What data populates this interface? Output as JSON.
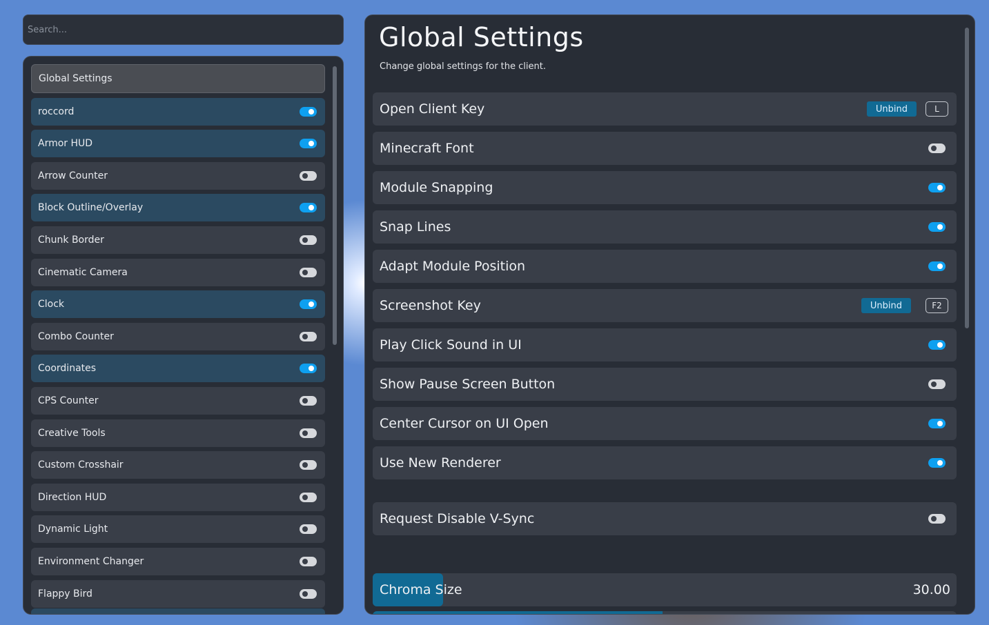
{
  "search": {
    "placeholder": "Search..."
  },
  "sidebar": {
    "items": [
      {
        "label": "Global Settings",
        "type": "header"
      },
      {
        "label": "roccord",
        "enabled": true
      },
      {
        "label": "Armor HUD",
        "enabled": true
      },
      {
        "label": "Arrow Counter",
        "enabled": false
      },
      {
        "label": "Block Outline/Overlay",
        "enabled": true
      },
      {
        "label": "Chunk Border",
        "enabled": false
      },
      {
        "label": "Cinematic Camera",
        "enabled": false
      },
      {
        "label": "Clock",
        "enabled": true
      },
      {
        "label": "Combo Counter",
        "enabled": false
      },
      {
        "label": "Coordinates",
        "enabled": true
      },
      {
        "label": "CPS Counter",
        "enabled": false
      },
      {
        "label": "Creative Tools",
        "enabled": false
      },
      {
        "label": "Custom Crosshair",
        "enabled": false
      },
      {
        "label": "Direction HUD",
        "enabled": false
      },
      {
        "label": "Dynamic Light",
        "enabled": false
      },
      {
        "label": "Environment Changer",
        "enabled": false
      },
      {
        "label": "Flappy Bird",
        "enabled": false
      }
    ]
  },
  "main": {
    "title": "Global Settings",
    "subtitle": "Change global settings for the client.",
    "settings": [
      {
        "label": "Open Client Key",
        "type": "keybind",
        "unbind_label": "Unbind",
        "key": "L"
      },
      {
        "label": "Minecraft Font",
        "type": "toggle",
        "enabled": false
      },
      {
        "label": "Module Snapping",
        "type": "toggle",
        "enabled": true
      },
      {
        "label": "Snap Lines",
        "type": "toggle",
        "enabled": true
      },
      {
        "label": "Adapt Module Position",
        "type": "toggle",
        "enabled": true
      },
      {
        "label": "Screenshot Key",
        "type": "keybind",
        "unbind_label": "Unbind",
        "key": "F2"
      },
      {
        "label": "Play Click Sound in UI",
        "type": "toggle",
        "enabled": true
      },
      {
        "label": "Show Pause Screen Button",
        "type": "toggle",
        "enabled": false
      },
      {
        "label": "Center Cursor on UI Open",
        "type": "toggle",
        "enabled": true
      },
      {
        "label": "Use New Renderer",
        "type": "toggle",
        "enabled": true
      },
      {
        "label": "Request Disable V-Sync",
        "type": "toggle",
        "enabled": false
      }
    ],
    "chroma": {
      "label": "Chroma Size",
      "value": "30.00",
      "fraction": 0.12
    }
  },
  "colors": {
    "accent": "#0ea0f0",
    "active_item": "#2b4a61",
    "unbind": "#116a94"
  }
}
